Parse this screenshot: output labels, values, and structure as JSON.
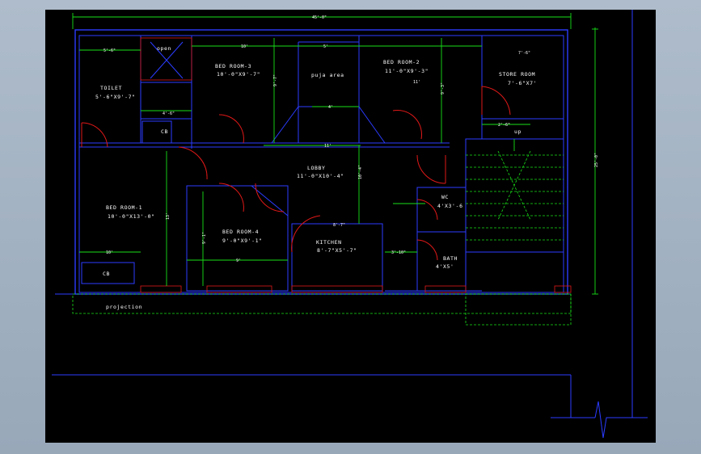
{
  "drawing": {
    "overall_width": "45'-0\"",
    "overall_depth": "25'-0\""
  },
  "rooms": {
    "toilet": {
      "name": "TOILET",
      "size": "5'-6\"X9'-7\""
    },
    "open": {
      "name": "open"
    },
    "bed3": {
      "name": "BED ROOM-3",
      "size": "10'-0\"X9'-7\""
    },
    "puja": {
      "name": "puja area"
    },
    "bed2": {
      "name": "BED ROOM-2",
      "size": "11'-0\"X9'-3\""
    },
    "store": {
      "name": "STORE ROOM",
      "size": "7'-6\"X7'"
    },
    "lobby": {
      "name": "LOBBY",
      "size": "11'-0\"X10'-4\""
    },
    "bed1": {
      "name": "BED ROOM-1",
      "size": "10'-0\"X13'-0\""
    },
    "wc": {
      "name": "WC",
      "size": "4'X3'-6"
    },
    "bed4": {
      "name": "BED ROOM-4",
      "size": "9'-0\"X9'-1\""
    },
    "kitchen": {
      "name": "KITCHEN",
      "size": "8'-7\"X5'-7\""
    },
    "bath": {
      "name": "BATH",
      "size": "4'X5'"
    },
    "cb_upper": {
      "name": "CB"
    },
    "cb_lower": {
      "name": "CB"
    },
    "up": {
      "name": "up"
    },
    "projection": {
      "name": "projection"
    }
  },
  "dimensions": {
    "d_toilet_w": "5'-6\"",
    "d_bed3_w": "10'",
    "d_puja_w": "5'",
    "d_bed2_w": "11'",
    "d_store_w": "7'-6\"",
    "d_toilet_h": "4'-6\"",
    "d_bed3_h": "9'-7\"",
    "d_bed2_h": "9'-3\"",
    "d_lobby_w": "11'",
    "d_lobby_h": "10'-4\"",
    "d_bed1_h": "13'",
    "d_bed1_w": "10'",
    "d_bed4_w": "9'",
    "d_bed4_h": "9'-1\"",
    "d_kitchen_w": "8'-7\"",
    "d_bath": "3'-10\"",
    "d_store_h": "2'-6\"",
    "d_puja_h": "4'"
  }
}
